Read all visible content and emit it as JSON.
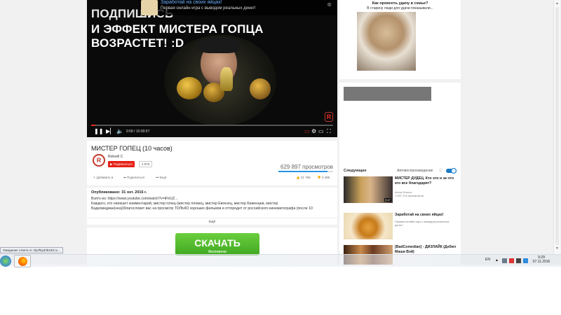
{
  "player": {
    "caption_line1": "ПОДПИШИСЬ",
    "caption_line2": "И ЭФФЕКТ МИСТЕРА ГОПЦА ВОЗРАСТЕТ! :D",
    "ad": {
      "title": "Заработай на своих яйцах!",
      "description": "Первая онлайн игра с выводом реальных денег!"
    },
    "time": "9:58 / 10:00:57",
    "progress": 0.017,
    "watermark": "R"
  },
  "video": {
    "title": "МИСТЕР ГОПЕЦ (10 часов)",
    "channel": "Rokvell C",
    "subscribe_label": "Подписаться",
    "subscriber_count": "2 876",
    "views": "629 897 просмотров",
    "actions": {
      "add": "Добавить в",
      "share": "Поделиться",
      "more": "Ещё"
    },
    "likes": "21 766",
    "dislikes": "2 495"
  },
  "description": {
    "published": "Опубликовано: 31 окт. 2016 г.",
    "lines": [
      "Взято из: https://www.youtube.com/watch?v=tFtrUZ...",
      "Каждого, кто напишет комментарий, мистер гопец (мистер пловец, мистер Евгенец, мистер Баженцев, мистер",
      "Бадкомедиан(неа))благословит вас на просмотр ТОЛЬКО хороших фильмов и оттородит от российского кинематографа (после 10"
    ],
    "more": "ещё"
  },
  "download": {
    "label": "СКАЧАТЬ",
    "sub": "бесплатно"
  },
  "side_ad": {
    "title": "Как прояепть удачу в семье?",
    "subtitle": "В старину люди для удачи показывали..."
  },
  "sidebar": {
    "next_label": "Следующее",
    "autoplay_label": "Автовоспроизведение",
    "autoplay_on": true,
    "items": [
      {
        "title": "МИСТЕР ДУДЕЦ. Кто это и за что его все благодарят?",
        "channel": "Arrow Dronov",
        "views": "1 697 213 просмотров",
        "duration": "5:47"
      },
      {
        "title": "Заработай на своих яйцах!",
        "channel": "Первая онлайн игра с выводом реальных денег!",
        "views": "",
        "duration": ""
      },
      {
        "title": "[BadComedian] - ДИЗЛАЙК (Дебют Маши Вэй)",
        "channel": "",
        "views": "",
        "duration": ""
      }
    ]
  },
  "status_bar": {
    "text": "Ожидание ответа от 4ly2f6yd3b2dd.ru...",
    "tooltip": "Сов"
  },
  "taskbar": {
    "lang": "EN",
    "time": "9:29",
    "date": "07.11.2016"
  },
  "colors": {
    "youtube_red": "#e62117",
    "download_green": "#4cb52a",
    "autoplay_blue": "#167ac6"
  }
}
